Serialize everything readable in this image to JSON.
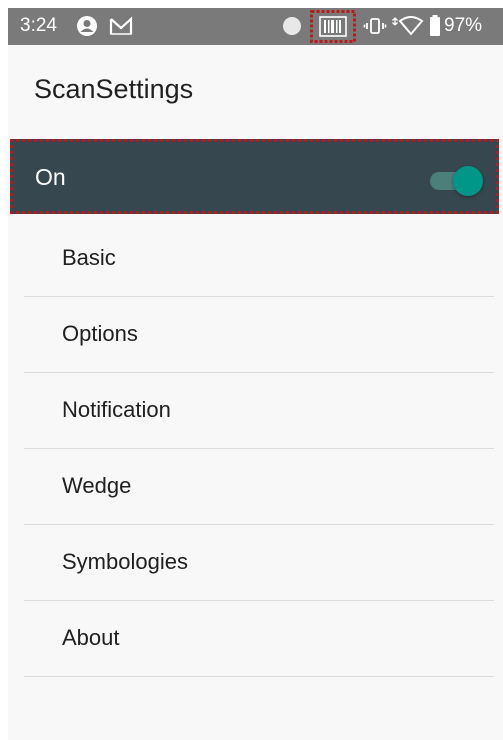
{
  "status_bar": {
    "time": "3:24",
    "battery": "97%",
    "icons": [
      "account-circle-icon",
      "gmail-icon",
      "dot-icon",
      "barcode-scanner-icon",
      "vibrate-icon",
      "wifi-icon",
      "battery-icon"
    ]
  },
  "app": {
    "title": "ScanSettings"
  },
  "toggle": {
    "label": "On",
    "state": true,
    "accent": "#009688"
  },
  "menu": {
    "items": [
      {
        "label": "Basic"
      },
      {
        "label": "Options"
      },
      {
        "label": "Notification"
      },
      {
        "label": "Wedge"
      },
      {
        "label": "Symbologies"
      },
      {
        "label": "About"
      }
    ]
  }
}
